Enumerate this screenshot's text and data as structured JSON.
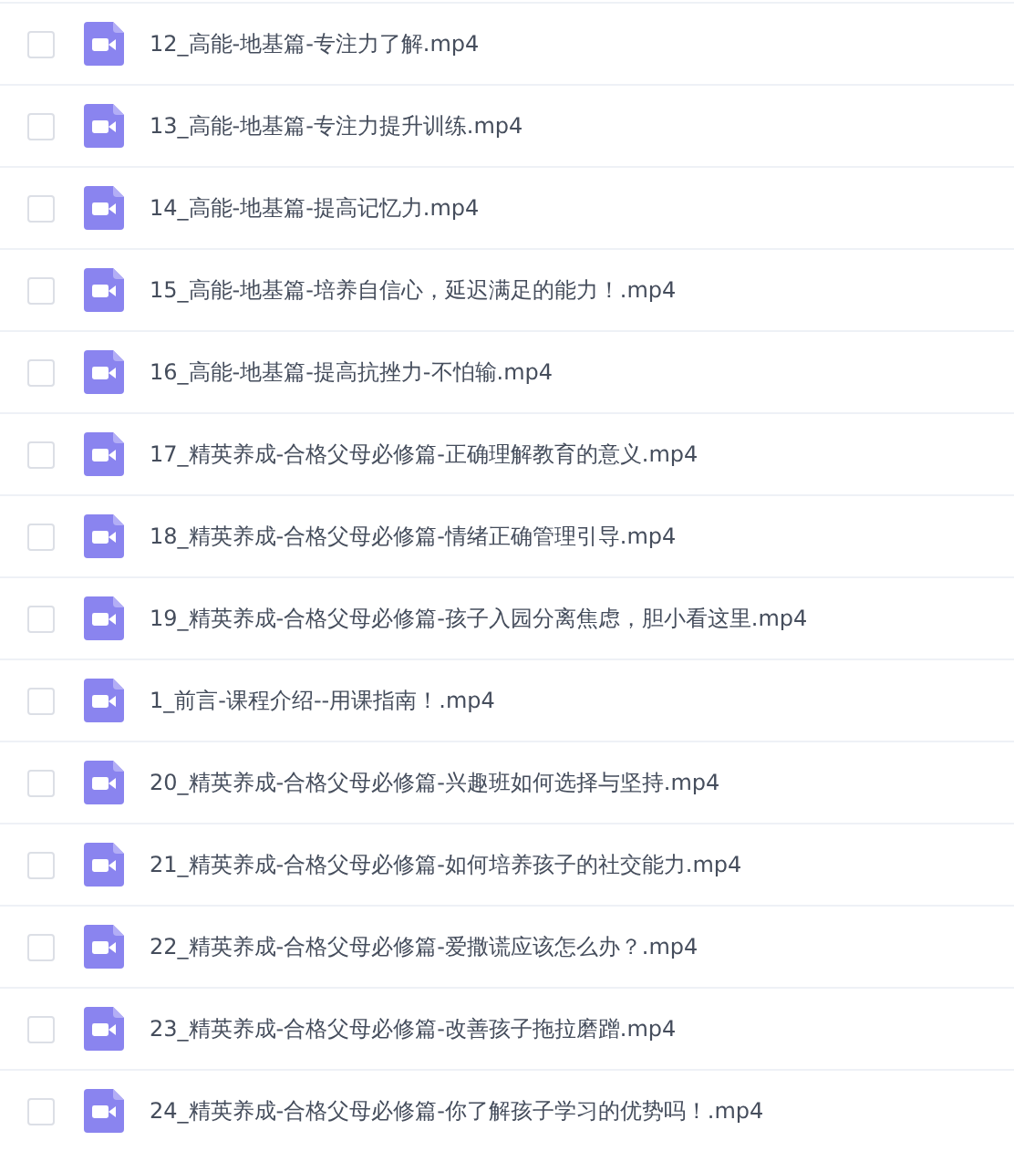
{
  "files": [
    {
      "name": "12_高能-地基篇-专注力了解.mp4",
      "checked": false
    },
    {
      "name": "13_高能-地基篇-专注力提升训练.mp4",
      "checked": false
    },
    {
      "name": "14_高能-地基篇-提高记忆力.mp4",
      "checked": false
    },
    {
      "name": "15_高能-地基篇-培养自信心，延迟满足的能力！.mp4",
      "checked": false
    },
    {
      "name": "16_高能-地基篇-提高抗挫力-不怕输.mp4",
      "checked": false
    },
    {
      "name": "17_精英养成-合格父母必修篇-正确理解教育的意义.mp4",
      "checked": false
    },
    {
      "name": "18_精英养成-合格父母必修篇-情绪正确管理引导.mp4",
      "checked": false
    },
    {
      "name": "19_精英养成-合格父母必修篇-孩子入园分离焦虑，胆小看这里.mp4",
      "checked": false
    },
    {
      "name": "1_前言-课程介绍--用课指南！.mp4",
      "checked": false
    },
    {
      "name": "20_精英养成-合格父母必修篇-兴趣班如何选择与坚持.mp4",
      "checked": false
    },
    {
      "name": "21_精英养成-合格父母必修篇-如何培养孩子的社交能力.mp4",
      "checked": false
    },
    {
      "name": "22_精英养成-合格父母必修篇-爱撒谎应该怎么办？.mp4",
      "checked": false
    },
    {
      "name": "23_精英养成-合格父母必修篇-改善孩子拖拉磨蹭.mp4",
      "checked": false
    },
    {
      "name": "24_精英养成-合格父母必修篇-你了解孩子学习的优势吗！.mp4",
      "checked": false
    }
  ]
}
